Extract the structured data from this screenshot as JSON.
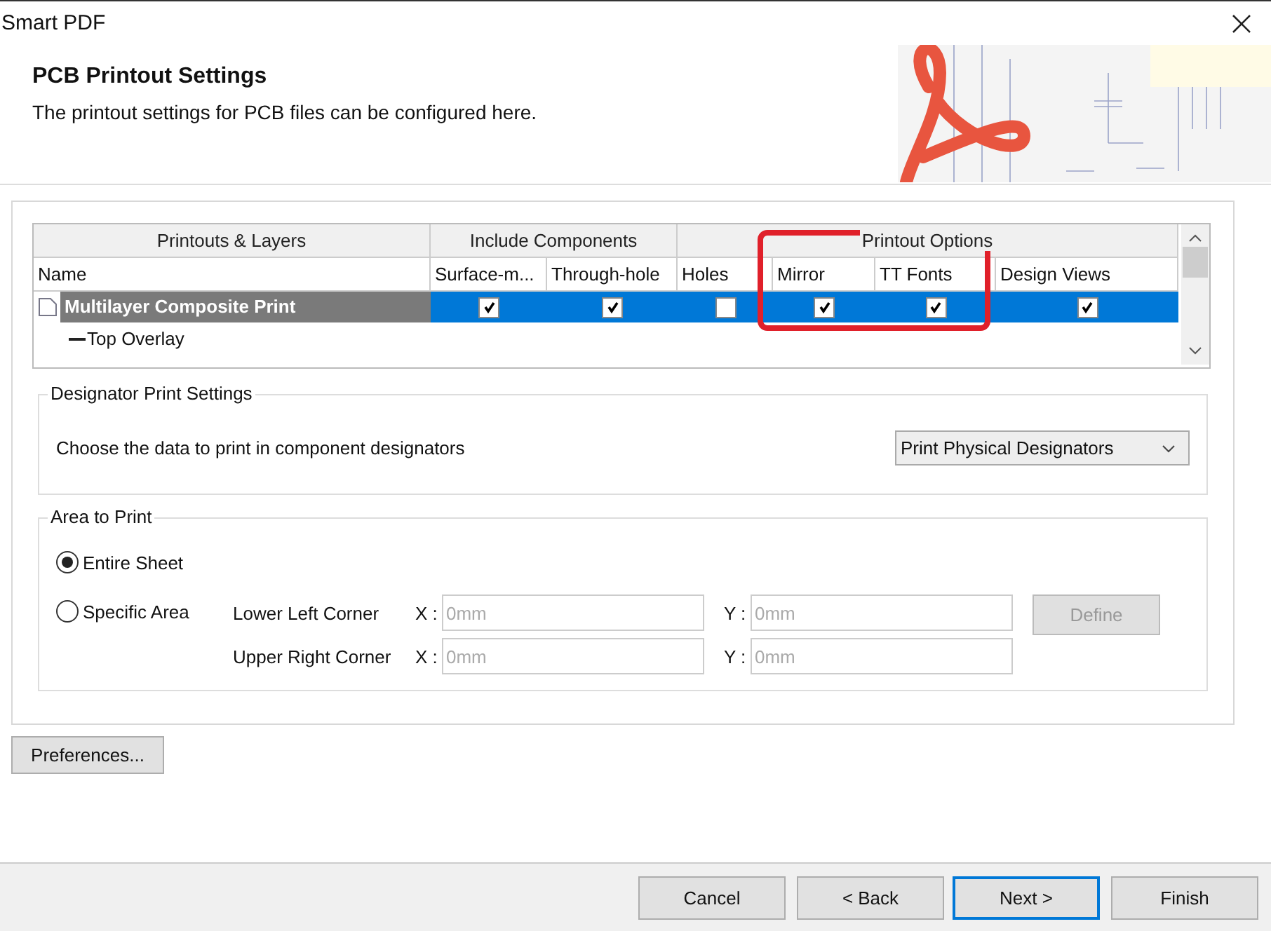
{
  "window": {
    "title": "Smart PDF"
  },
  "header": {
    "title": "PCB Printout Settings",
    "subtitle": "The printout settings for PCB files can be configured here."
  },
  "layers_table": {
    "groups": [
      {
        "label": "Printouts & Layers",
        "columns": [
          "Name"
        ]
      },
      {
        "label": "Include Components",
        "columns": [
          "Surface-m...",
          "Through-hole"
        ]
      },
      {
        "label": "Printout Options",
        "columns": [
          "Holes",
          "Mirror",
          "TT Fonts",
          "Design Views"
        ]
      }
    ],
    "rows": [
      {
        "name": "Multilayer Composite Print",
        "kind": "printout",
        "selected": true,
        "checks": [
          true,
          true,
          false,
          true,
          true,
          true
        ],
        "children": [
          {
            "name": "Top Overlay",
            "kind": "layer"
          }
        ]
      }
    ]
  },
  "annotations": [
    {
      "kind": "frame",
      "color": "#e0202a"
    }
  ],
  "designator_settings": {
    "legend": "Designator Print Settings",
    "label": "Choose the data to print in component designators",
    "dropdown": "Print Physical Designators"
  },
  "area_to_print": {
    "legend": "Area to Print",
    "options": [
      {
        "label": "Entire Sheet",
        "selected": true
      },
      {
        "label": "Specific Area",
        "selected": false
      }
    ],
    "corners": [
      {
        "label": "Lower Left Corner",
        "x_label": "X :",
        "x_value": "0mm",
        "y_label": "Y :",
        "y_value": "0mm"
      },
      {
        "label": "Upper Right Corner",
        "x_label": "X :",
        "x_value": "0mm",
        "y_label": "Y :",
        "y_value": "0mm"
      }
    ],
    "fields_disabled": true,
    "define_button": {
      "label": "Define",
      "disabled": true
    }
  },
  "preferences_button": "Preferences...",
  "buttons": [
    {
      "label": "Cancel",
      "default": false
    },
    {
      "label": "< Back",
      "default": false
    },
    {
      "label": "Next >",
      "default": true
    },
    {
      "label": "Finish",
      "default": false
    }
  ]
}
